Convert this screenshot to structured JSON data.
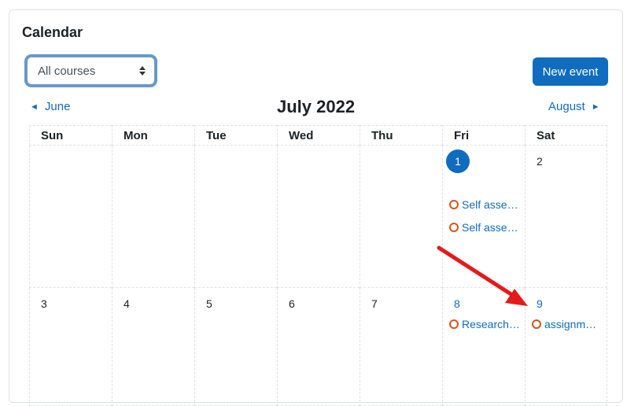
{
  "calendar": {
    "title": "Calendar",
    "course_filter": {
      "selected": "All courses"
    },
    "new_event_label": "New event",
    "prev_month": "June",
    "next_month": "August",
    "month_title": "July 2022",
    "weekdays": [
      "Sun",
      "Mon",
      "Tue",
      "Wed",
      "Thu",
      "Fri",
      "Sat"
    ],
    "weeks": [
      {
        "days": [
          {
            "num": "",
            "events": []
          },
          {
            "num": "",
            "events": []
          },
          {
            "num": "",
            "events": []
          },
          {
            "num": "",
            "events": []
          },
          {
            "num": "",
            "events": []
          },
          {
            "num": "1",
            "today": true,
            "events": [
              "Self asse…",
              "Self asse…"
            ]
          },
          {
            "num": "2",
            "events": []
          }
        ]
      },
      {
        "days": [
          {
            "num": "3",
            "events": []
          },
          {
            "num": "4",
            "events": []
          },
          {
            "num": "5",
            "events": []
          },
          {
            "num": "6",
            "events": []
          },
          {
            "num": "7",
            "events": []
          },
          {
            "num": "8",
            "link": true,
            "events": [
              "Research…"
            ]
          },
          {
            "num": "9",
            "link": true,
            "events": [
              "assignm…"
            ]
          }
        ]
      }
    ],
    "colors": {
      "accent": "#0f6cbf",
      "event_icon": "#d9531e",
      "annotation_arrow": "#e31b1b"
    }
  }
}
